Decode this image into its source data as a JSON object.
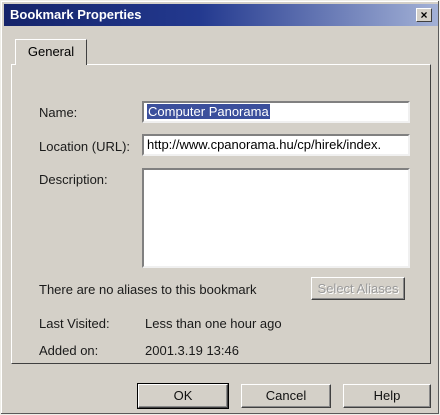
{
  "window": {
    "title": "Bookmark Properties",
    "close_glyph": "×"
  },
  "tabs": [
    {
      "label": "General"
    }
  ],
  "form": {
    "name_label": "Name:",
    "name_value": "Computer Panorama",
    "location_label": "Location (URL):",
    "location_value": "http://www.cpanorama.hu/cp/hirek/index.",
    "description_label": "Description:",
    "description_value": ""
  },
  "aliases": {
    "text": "There are no aliases to this bookmark",
    "button_label": "Select Aliases"
  },
  "info": {
    "last_visited_label": "Last Visited:",
    "last_visited_value": "Less than one hour ago",
    "added_on_label": "Added on:",
    "added_on_value": "2001.3.19 13:46"
  },
  "buttons": {
    "ok": "OK",
    "cancel": "Cancel",
    "help": "Help"
  }
}
